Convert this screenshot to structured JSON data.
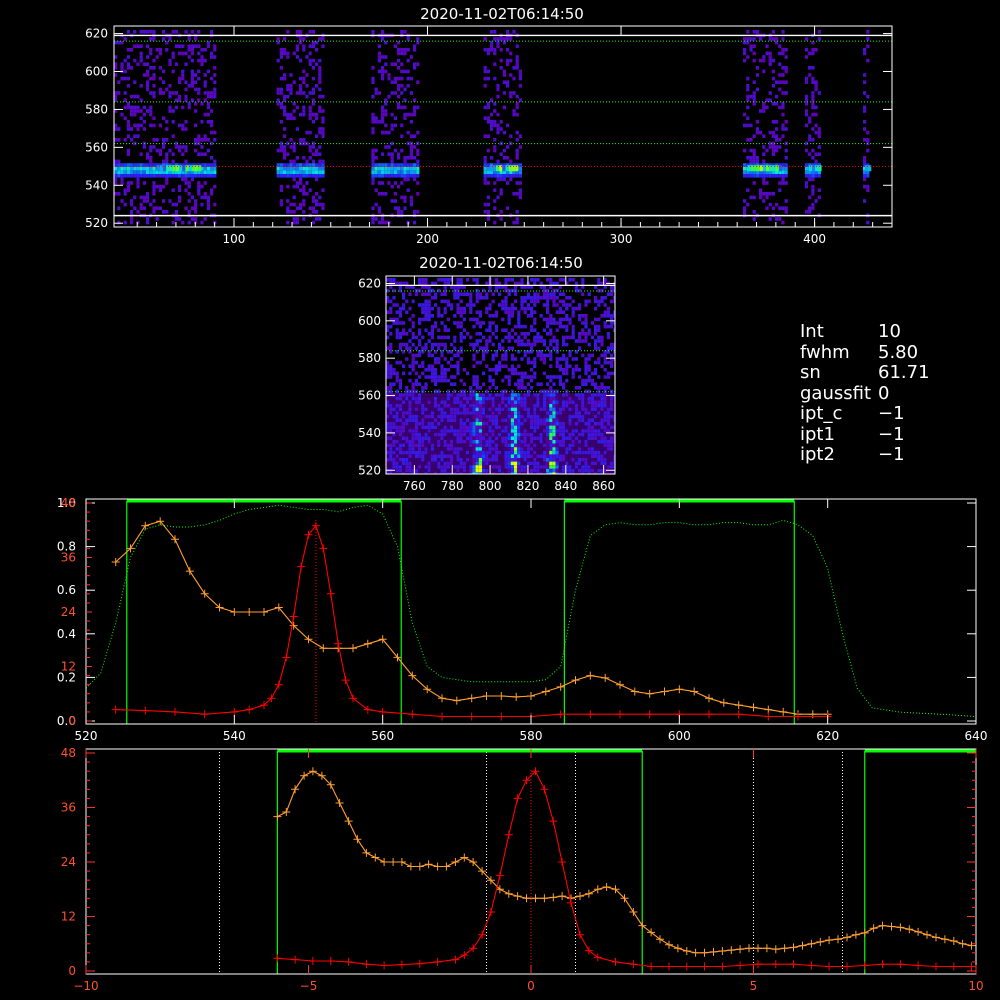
{
  "chart_data": [
    {
      "id": "slit-overview",
      "type": "heatmap",
      "title": "2020-11-02T06:14:50",
      "xlim": [
        38,
        440
      ],
      "ylim": [
        518,
        624
      ],
      "x_ticks": [
        100,
        200,
        300,
        400
      ],
      "y_ticks": [
        520,
        540,
        560,
        580,
        600,
        620
      ],
      "emission_band_y": 549,
      "bright_segments_x": [
        [
          38,
          90
        ],
        [
          122,
          146
        ],
        [
          171,
          195
        ],
        [
          229,
          248
        ],
        [
          363,
          385
        ],
        [
          395,
          402
        ],
        [
          425,
          428
        ]
      ],
      "bright_cores_x": [
        [
          60,
          82
        ],
        [
          232,
          246
        ],
        [
          365,
          383
        ],
        [
          397,
          403
        ],
        [
          426,
          428
        ]
      ],
      "horizontal_lines": {
        "white_solid_y": [
          524,
          619
        ],
        "green_dotted_y": [
          562,
          584,
          616
        ],
        "red_dotted_y": [
          550
        ]
      },
      "colors": {
        "frame": "#ffffff",
        "green": "#00ff00",
        "red": "#ff0000"
      }
    },
    {
      "id": "zoom-region",
      "type": "heatmap",
      "title": "2020-11-02T06:14:50",
      "xlim": [
        745,
        866
      ],
      "ylim": [
        518,
        624
      ],
      "x_ticks": [
        760,
        780,
        800,
        820,
        840,
        860
      ],
      "y_ticks": [
        520,
        540,
        560,
        580,
        600,
        620
      ],
      "bright_streaks_x": [
        793,
        812,
        832
      ],
      "horizontal_lines": {
        "white_solid_y": [
          619
        ],
        "green_dotted_y": [
          562,
          584,
          616
        ]
      }
    },
    {
      "id": "filter-spectrum",
      "type": "line",
      "xlim": [
        520,
        640
      ],
      "ylim_left": [
        0,
        1.0
      ],
      "ylim_right": [
        0,
        48
      ],
      "x_ticks": [
        520,
        540,
        560,
        580,
        600,
        620,
        640
      ],
      "y_ticks_left": [
        0.0,
        0.2,
        0.4,
        0.6,
        0.8,
        1.0
      ],
      "y_ticks_right": [
        0,
        12,
        24,
        36,
        48
      ],
      "filter_bands": [
        [
          525.5,
          562.5
        ],
        [
          584.5,
          615.5
        ]
      ],
      "dotted_marker_x": [
        551
      ],
      "series": [
        {
          "color": "#ffa030",
          "x": [
            524,
            526,
            528,
            530,
            532,
            534,
            536,
            538,
            540,
            542,
            544,
            546,
            548,
            550,
            552,
            554,
            556,
            558,
            560,
            562,
            564,
            566,
            568,
            570,
            572,
            574,
            576,
            578,
            580,
            582,
            584,
            586,
            588,
            590,
            592,
            594,
            596,
            598,
            600,
            602,
            604,
            606,
            608,
            610,
            612,
            614,
            616,
            618,
            620
          ],
          "y": [
            35,
            38,
            43,
            44,
            40,
            33,
            28,
            25,
            24,
            24,
            24,
            25,
            21,
            18,
            16,
            16,
            16,
            17,
            18,
            14,
            10,
            7,
            5,
            4.5,
            5,
            5.5,
            5.5,
            5.3,
            5.5,
            6.5,
            7.5,
            9,
            10,
            9.5,
            8,
            6.5,
            6,
            6.5,
            7,
            6.5,
            5,
            4,
            3.5,
            3,
            2.5,
            2,
            1.5,
            1.5,
            1.5
          ]
        },
        {
          "color": "#ff0000",
          "x": [
            524,
            528,
            532,
            536,
            540,
            542,
            544,
            545,
            546,
            547,
            548,
            549,
            550,
            551,
            552,
            553,
            554,
            555,
            556,
            558,
            560,
            564,
            568,
            572,
            576,
            580,
            584,
            588,
            592,
            596,
            600,
            604,
            608,
            612,
            616,
            620
          ],
          "y": [
            2.5,
            2.3,
            2,
            1.5,
            2,
            2.5,
            3.5,
            5,
            8,
            14,
            23,
            34,
            41,
            43,
            38,
            28,
            17,
            9,
            5,
            2.5,
            2,
            1.5,
            1,
            1,
            1,
            1,
            1.5,
            1.5,
            1.5,
            1.5,
            1.5,
            1.5,
            1.5,
            1,
            1,
            1
          ]
        },
        {
          "color": "#00ff00",
          "axis": "left",
          "x": [
            520,
            522,
            524,
            526,
            528,
            530,
            532,
            534,
            536,
            538,
            540,
            542,
            544,
            546,
            548,
            550,
            552,
            554,
            556,
            558,
            560,
            562,
            564,
            566,
            568,
            570,
            572,
            574,
            576,
            578,
            580,
            582,
            584,
            586,
            588,
            590,
            592,
            594,
            596,
            598,
            600,
            602,
            604,
            606,
            608,
            610,
            612,
            614,
            616,
            618,
            620,
            622,
            624,
            626,
            630,
            636,
            640
          ],
          "y": [
            0.15,
            0.22,
            0.45,
            0.75,
            0.88,
            0.9,
            0.89,
            0.89,
            0.9,
            0.92,
            0.95,
            0.97,
            0.98,
            0.99,
            0.98,
            0.97,
            0.97,
            0.96,
            0.98,
            0.99,
            0.95,
            0.8,
            0.45,
            0.25,
            0.2,
            0.19,
            0.18,
            0.18,
            0.18,
            0.18,
            0.18,
            0.19,
            0.25,
            0.6,
            0.85,
            0.9,
            0.91,
            0.9,
            0.9,
            0.91,
            0.91,
            0.9,
            0.9,
            0.91,
            0.91,
            0.9,
            0.9,
            0.92,
            0.9,
            0.85,
            0.7,
            0.4,
            0.15,
            0.06,
            0.04,
            0.03,
            0.02
          ]
        }
      ]
    },
    {
      "id": "line-profile",
      "type": "line",
      "xlim": [
        -10,
        10
      ],
      "ylim": [
        0,
        48
      ],
      "x_ticks": [
        -10,
        -5,
        0,
        5,
        10
      ],
      "y_ticks": [
        0,
        12,
        24,
        36,
        48
      ],
      "filter_bands": [
        [
          -5.7,
          2.5
        ],
        [
          7.5,
          10
        ]
      ],
      "dotted_white_x": [
        -7,
        -1,
        1,
        5,
        7
      ],
      "dotted_red_x": [
        0
      ],
      "series": [
        {
          "color": "#ffa030",
          "x": [
            -5.7,
            -5.5,
            -5.3,
            -5.1,
            -4.9,
            -4.7,
            -4.5,
            -4.3,
            -4.1,
            -3.9,
            -3.7,
            -3.5,
            -3.3,
            -3.1,
            -2.9,
            -2.7,
            -2.5,
            -2.3,
            -2.1,
            -1.9,
            -1.7,
            -1.5,
            -1.3,
            -1.1,
            -0.9,
            -0.7,
            -0.5,
            -0.3,
            -0.1,
            0.1,
            0.3,
            0.5,
            0.7,
            0.9,
            1.1,
            1.3,
            1.5,
            1.7,
            1.9,
            2.1,
            2.3,
            2.5,
            2.7,
            2.9,
            3.1,
            3.3,
            3.5,
            3.7,
            3.9,
            4.1,
            4.3,
            4.5,
            4.7,
            4.9,
            5.1,
            5.3,
            5.5,
            5.7,
            5.9,
            6.1,
            6.3,
            6.5,
            6.7,
            6.9,
            7.1,
            7.3,
            7.5,
            7.7,
            7.9,
            8.1,
            8.3,
            8.5,
            8.7,
            8.9,
            9.1,
            9.3,
            9.5,
            9.7,
            9.9
          ],
          "y": [
            34,
            35,
            40,
            43,
            44,
            43,
            41,
            37,
            33,
            29,
            26,
            25,
            24,
            24,
            24,
            23,
            23,
            23.5,
            23,
            23,
            24,
            25,
            24,
            22,
            20,
            18,
            17,
            16.5,
            16,
            16,
            16,
            16.2,
            16.5,
            16,
            16.5,
            17,
            18,
            18.5,
            18,
            16,
            13,
            10,
            8.5,
            7,
            5.8,
            5,
            4.4,
            4,
            4,
            4.2,
            4.4,
            4.6,
            4.8,
            5,
            5,
            5,
            4.8,
            5,
            5.2,
            5.6,
            6,
            6.4,
            6.8,
            7,
            7.4,
            8,
            8.4,
            9.4,
            10,
            9.8,
            9.6,
            9.2,
            8.6,
            8,
            7.4,
            7,
            6.6,
            6,
            5.6
          ]
        },
        {
          "color": "#ff0000",
          "x": [
            -5.7,
            -5.3,
            -4.9,
            -4.5,
            -4.1,
            -3.7,
            -3.3,
            -2.9,
            -2.5,
            -2.1,
            -1.7,
            -1.5,
            -1.3,
            -1.1,
            -0.9,
            -0.7,
            -0.5,
            -0.3,
            -0.1,
            0.1,
            0.3,
            0.5,
            0.7,
            0.9,
            1.1,
            1.3,
            1.5,
            1.9,
            2.3,
            2.7,
            3.1,
            3.5,
            3.9,
            4.3,
            4.7,
            5.1,
            5.5,
            5.9,
            6.3,
            6.7,
            7.1,
            7.5,
            7.9,
            8.3,
            8.7,
            9.1,
            9.5,
            9.9
          ],
          "y": [
            2.8,
            2.5,
            2.2,
            2.2,
            2,
            1.5,
            1.2,
            1.4,
            1.6,
            2,
            2.5,
            3.5,
            5,
            8,
            13,
            21,
            30,
            38,
            42,
            44,
            40,
            33,
            24,
            15,
            8,
            4.5,
            3,
            2,
            1.5,
            1,
            1,
            1,
            1,
            1,
            1.2,
            1.5,
            1.5,
            1.5,
            1.2,
            1,
            1,
            1.2,
            1.5,
            1.5,
            1.2,
            1,
            1,
            1
          ]
        }
      ]
    }
  ],
  "annotation": [
    {
      "key": "Int",
      "value": "10"
    },
    {
      "key": "fwhm",
      "value": "5.80"
    },
    {
      "key": "sn",
      "value": "61.71"
    },
    {
      "key": "gaussfit",
      "value": "0"
    },
    {
      "key": "ipt_c",
      "value": "−1"
    },
    {
      "key": "ipt1",
      "value": "−1"
    },
    {
      "key": "ipt2",
      "value": "−1"
    }
  ]
}
